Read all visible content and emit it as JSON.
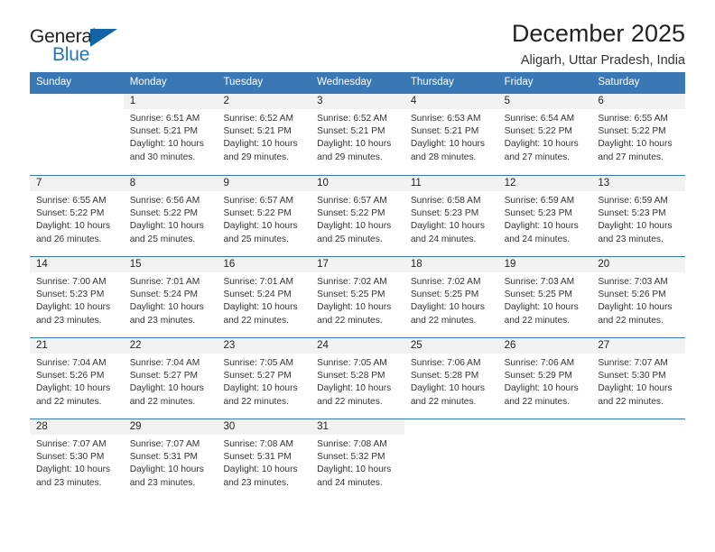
{
  "logo": {
    "word_top": "General",
    "word_bottom": "Blue",
    "triangle_icon": "blue-triangle-icon"
  },
  "header": {
    "title": "December 2025",
    "subtitle": "Aligarh, Uttar Pradesh, India"
  },
  "colors": {
    "header_blue": "#3a77b5",
    "logo_blue": "#2175bc",
    "day_band_gray": "#f2f2f2",
    "text": "#222222"
  },
  "weekdays": [
    "Sunday",
    "Monday",
    "Tuesday",
    "Wednesday",
    "Thursday",
    "Friday",
    "Saturday"
  ],
  "weeks": [
    [
      {
        "empty": true
      },
      {
        "day": "1",
        "sunrise": "Sunrise: 6:51 AM",
        "sunset": "Sunset: 5:21 PM",
        "daylight1": "Daylight: 10 hours",
        "daylight2": "and 30 minutes."
      },
      {
        "day": "2",
        "sunrise": "Sunrise: 6:52 AM",
        "sunset": "Sunset: 5:21 PM",
        "daylight1": "Daylight: 10 hours",
        "daylight2": "and 29 minutes."
      },
      {
        "day": "3",
        "sunrise": "Sunrise: 6:52 AM",
        "sunset": "Sunset: 5:21 PM",
        "daylight1": "Daylight: 10 hours",
        "daylight2": "and 29 minutes."
      },
      {
        "day": "4",
        "sunrise": "Sunrise: 6:53 AM",
        "sunset": "Sunset: 5:21 PM",
        "daylight1": "Daylight: 10 hours",
        "daylight2": "and 28 minutes."
      },
      {
        "day": "5",
        "sunrise": "Sunrise: 6:54 AM",
        "sunset": "Sunset: 5:22 PM",
        "daylight1": "Daylight: 10 hours",
        "daylight2": "and 27 minutes."
      },
      {
        "day": "6",
        "sunrise": "Sunrise: 6:55 AM",
        "sunset": "Sunset: 5:22 PM",
        "daylight1": "Daylight: 10 hours",
        "daylight2": "and 27 minutes."
      }
    ],
    [
      {
        "day": "7",
        "sunrise": "Sunrise: 6:55 AM",
        "sunset": "Sunset: 5:22 PM",
        "daylight1": "Daylight: 10 hours",
        "daylight2": "and 26 minutes."
      },
      {
        "day": "8",
        "sunrise": "Sunrise: 6:56 AM",
        "sunset": "Sunset: 5:22 PM",
        "daylight1": "Daylight: 10 hours",
        "daylight2": "and 25 minutes."
      },
      {
        "day": "9",
        "sunrise": "Sunrise: 6:57 AM",
        "sunset": "Sunset: 5:22 PM",
        "daylight1": "Daylight: 10 hours",
        "daylight2": "and 25 minutes."
      },
      {
        "day": "10",
        "sunrise": "Sunrise: 6:57 AM",
        "sunset": "Sunset: 5:22 PM",
        "daylight1": "Daylight: 10 hours",
        "daylight2": "and 25 minutes."
      },
      {
        "day": "11",
        "sunrise": "Sunrise: 6:58 AM",
        "sunset": "Sunset: 5:23 PM",
        "daylight1": "Daylight: 10 hours",
        "daylight2": "and 24 minutes."
      },
      {
        "day": "12",
        "sunrise": "Sunrise: 6:59 AM",
        "sunset": "Sunset: 5:23 PM",
        "daylight1": "Daylight: 10 hours",
        "daylight2": "and 24 minutes."
      },
      {
        "day": "13",
        "sunrise": "Sunrise: 6:59 AM",
        "sunset": "Sunset: 5:23 PM",
        "daylight1": "Daylight: 10 hours",
        "daylight2": "and 23 minutes."
      }
    ],
    [
      {
        "day": "14",
        "sunrise": "Sunrise: 7:00 AM",
        "sunset": "Sunset: 5:23 PM",
        "daylight1": "Daylight: 10 hours",
        "daylight2": "and 23 minutes."
      },
      {
        "day": "15",
        "sunrise": "Sunrise: 7:01 AM",
        "sunset": "Sunset: 5:24 PM",
        "daylight1": "Daylight: 10 hours",
        "daylight2": "and 23 minutes."
      },
      {
        "day": "16",
        "sunrise": "Sunrise: 7:01 AM",
        "sunset": "Sunset: 5:24 PM",
        "daylight1": "Daylight: 10 hours",
        "daylight2": "and 22 minutes."
      },
      {
        "day": "17",
        "sunrise": "Sunrise: 7:02 AM",
        "sunset": "Sunset: 5:25 PM",
        "daylight1": "Daylight: 10 hours",
        "daylight2": "and 22 minutes."
      },
      {
        "day": "18",
        "sunrise": "Sunrise: 7:02 AM",
        "sunset": "Sunset: 5:25 PM",
        "daylight1": "Daylight: 10 hours",
        "daylight2": "and 22 minutes."
      },
      {
        "day": "19",
        "sunrise": "Sunrise: 7:03 AM",
        "sunset": "Sunset: 5:25 PM",
        "daylight1": "Daylight: 10 hours",
        "daylight2": "and 22 minutes."
      },
      {
        "day": "20",
        "sunrise": "Sunrise: 7:03 AM",
        "sunset": "Sunset: 5:26 PM",
        "daylight1": "Daylight: 10 hours",
        "daylight2": "and 22 minutes."
      }
    ],
    [
      {
        "day": "21",
        "sunrise": "Sunrise: 7:04 AM",
        "sunset": "Sunset: 5:26 PM",
        "daylight1": "Daylight: 10 hours",
        "daylight2": "and 22 minutes."
      },
      {
        "day": "22",
        "sunrise": "Sunrise: 7:04 AM",
        "sunset": "Sunset: 5:27 PM",
        "daylight1": "Daylight: 10 hours",
        "daylight2": "and 22 minutes."
      },
      {
        "day": "23",
        "sunrise": "Sunrise: 7:05 AM",
        "sunset": "Sunset: 5:27 PM",
        "daylight1": "Daylight: 10 hours",
        "daylight2": "and 22 minutes."
      },
      {
        "day": "24",
        "sunrise": "Sunrise: 7:05 AM",
        "sunset": "Sunset: 5:28 PM",
        "daylight1": "Daylight: 10 hours",
        "daylight2": "and 22 minutes."
      },
      {
        "day": "25",
        "sunrise": "Sunrise: 7:06 AM",
        "sunset": "Sunset: 5:28 PM",
        "daylight1": "Daylight: 10 hours",
        "daylight2": "and 22 minutes."
      },
      {
        "day": "26",
        "sunrise": "Sunrise: 7:06 AM",
        "sunset": "Sunset: 5:29 PM",
        "daylight1": "Daylight: 10 hours",
        "daylight2": "and 22 minutes."
      },
      {
        "day": "27",
        "sunrise": "Sunrise: 7:07 AM",
        "sunset": "Sunset: 5:30 PM",
        "daylight1": "Daylight: 10 hours",
        "daylight2": "and 22 minutes."
      }
    ],
    [
      {
        "day": "28",
        "sunrise": "Sunrise: 7:07 AM",
        "sunset": "Sunset: 5:30 PM",
        "daylight1": "Daylight: 10 hours",
        "daylight2": "and 23 minutes."
      },
      {
        "day": "29",
        "sunrise": "Sunrise: 7:07 AM",
        "sunset": "Sunset: 5:31 PM",
        "daylight1": "Daylight: 10 hours",
        "daylight2": "and 23 minutes."
      },
      {
        "day": "30",
        "sunrise": "Sunrise: 7:08 AM",
        "sunset": "Sunset: 5:31 PM",
        "daylight1": "Daylight: 10 hours",
        "daylight2": "and 23 minutes."
      },
      {
        "day": "31",
        "sunrise": "Sunrise: 7:08 AM",
        "sunset": "Sunset: 5:32 PM",
        "daylight1": "Daylight: 10 hours",
        "daylight2": "and 24 minutes."
      },
      {
        "empty": true
      },
      {
        "empty": true
      },
      {
        "empty": true
      }
    ]
  ]
}
